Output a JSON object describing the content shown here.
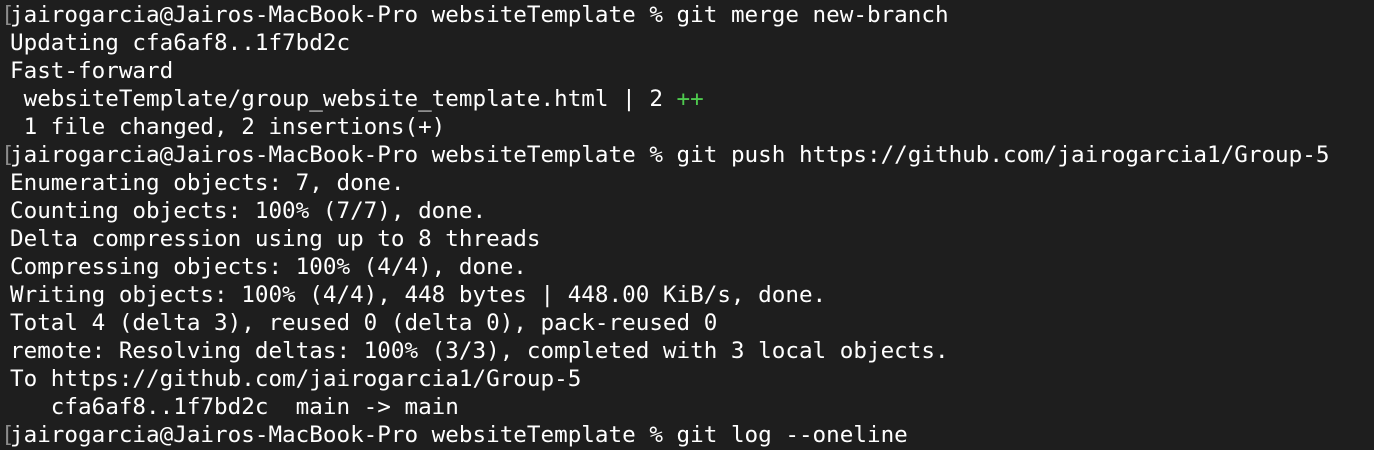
{
  "colors": {
    "background": "#1e1e1e",
    "text": "#ffffff",
    "diffstat_insertions": "#4ec94e"
  },
  "terminal": {
    "prompt": "jairogarcia@Jairos-MacBook-Pro websiteTemplate % ",
    "bracket_glyph": "[",
    "lines": {
      "cmd_merge": "git merge new-branch",
      "updating": "Updating cfa6af8..1f7bd2c",
      "fast_forward": "Fast-forward",
      "diffstat_file": " websiteTemplate/group_website_template.html | 2 ",
      "diffstat_plus": "++",
      "files_changed": " 1 file changed, 2 insertions(+)",
      "cmd_push": "git push https://github.com/jairogarcia1/Group-5",
      "enumerating": "Enumerating objects: 7, done.",
      "counting": "Counting objects: 100% (7/7), done.",
      "delta_compression": "Delta compression using up to 8 threads",
      "compressing": "Compressing objects: 100% (4/4), done.",
      "writing": "Writing objects: 100% (4/4), 448 bytes | 448.00 KiB/s, done.",
      "total": "Total 4 (delta 3), reused 0 (delta 0), pack-reused 0",
      "remote_resolving": "remote: Resolving deltas: 100% (3/3), completed with 3 local objects.",
      "to_url": "To https://github.com/jairogarcia1/Group-5",
      "ref_update": "   cfa6af8..1f7bd2c  main -> main",
      "cmd_log": "git log --oneline"
    }
  }
}
